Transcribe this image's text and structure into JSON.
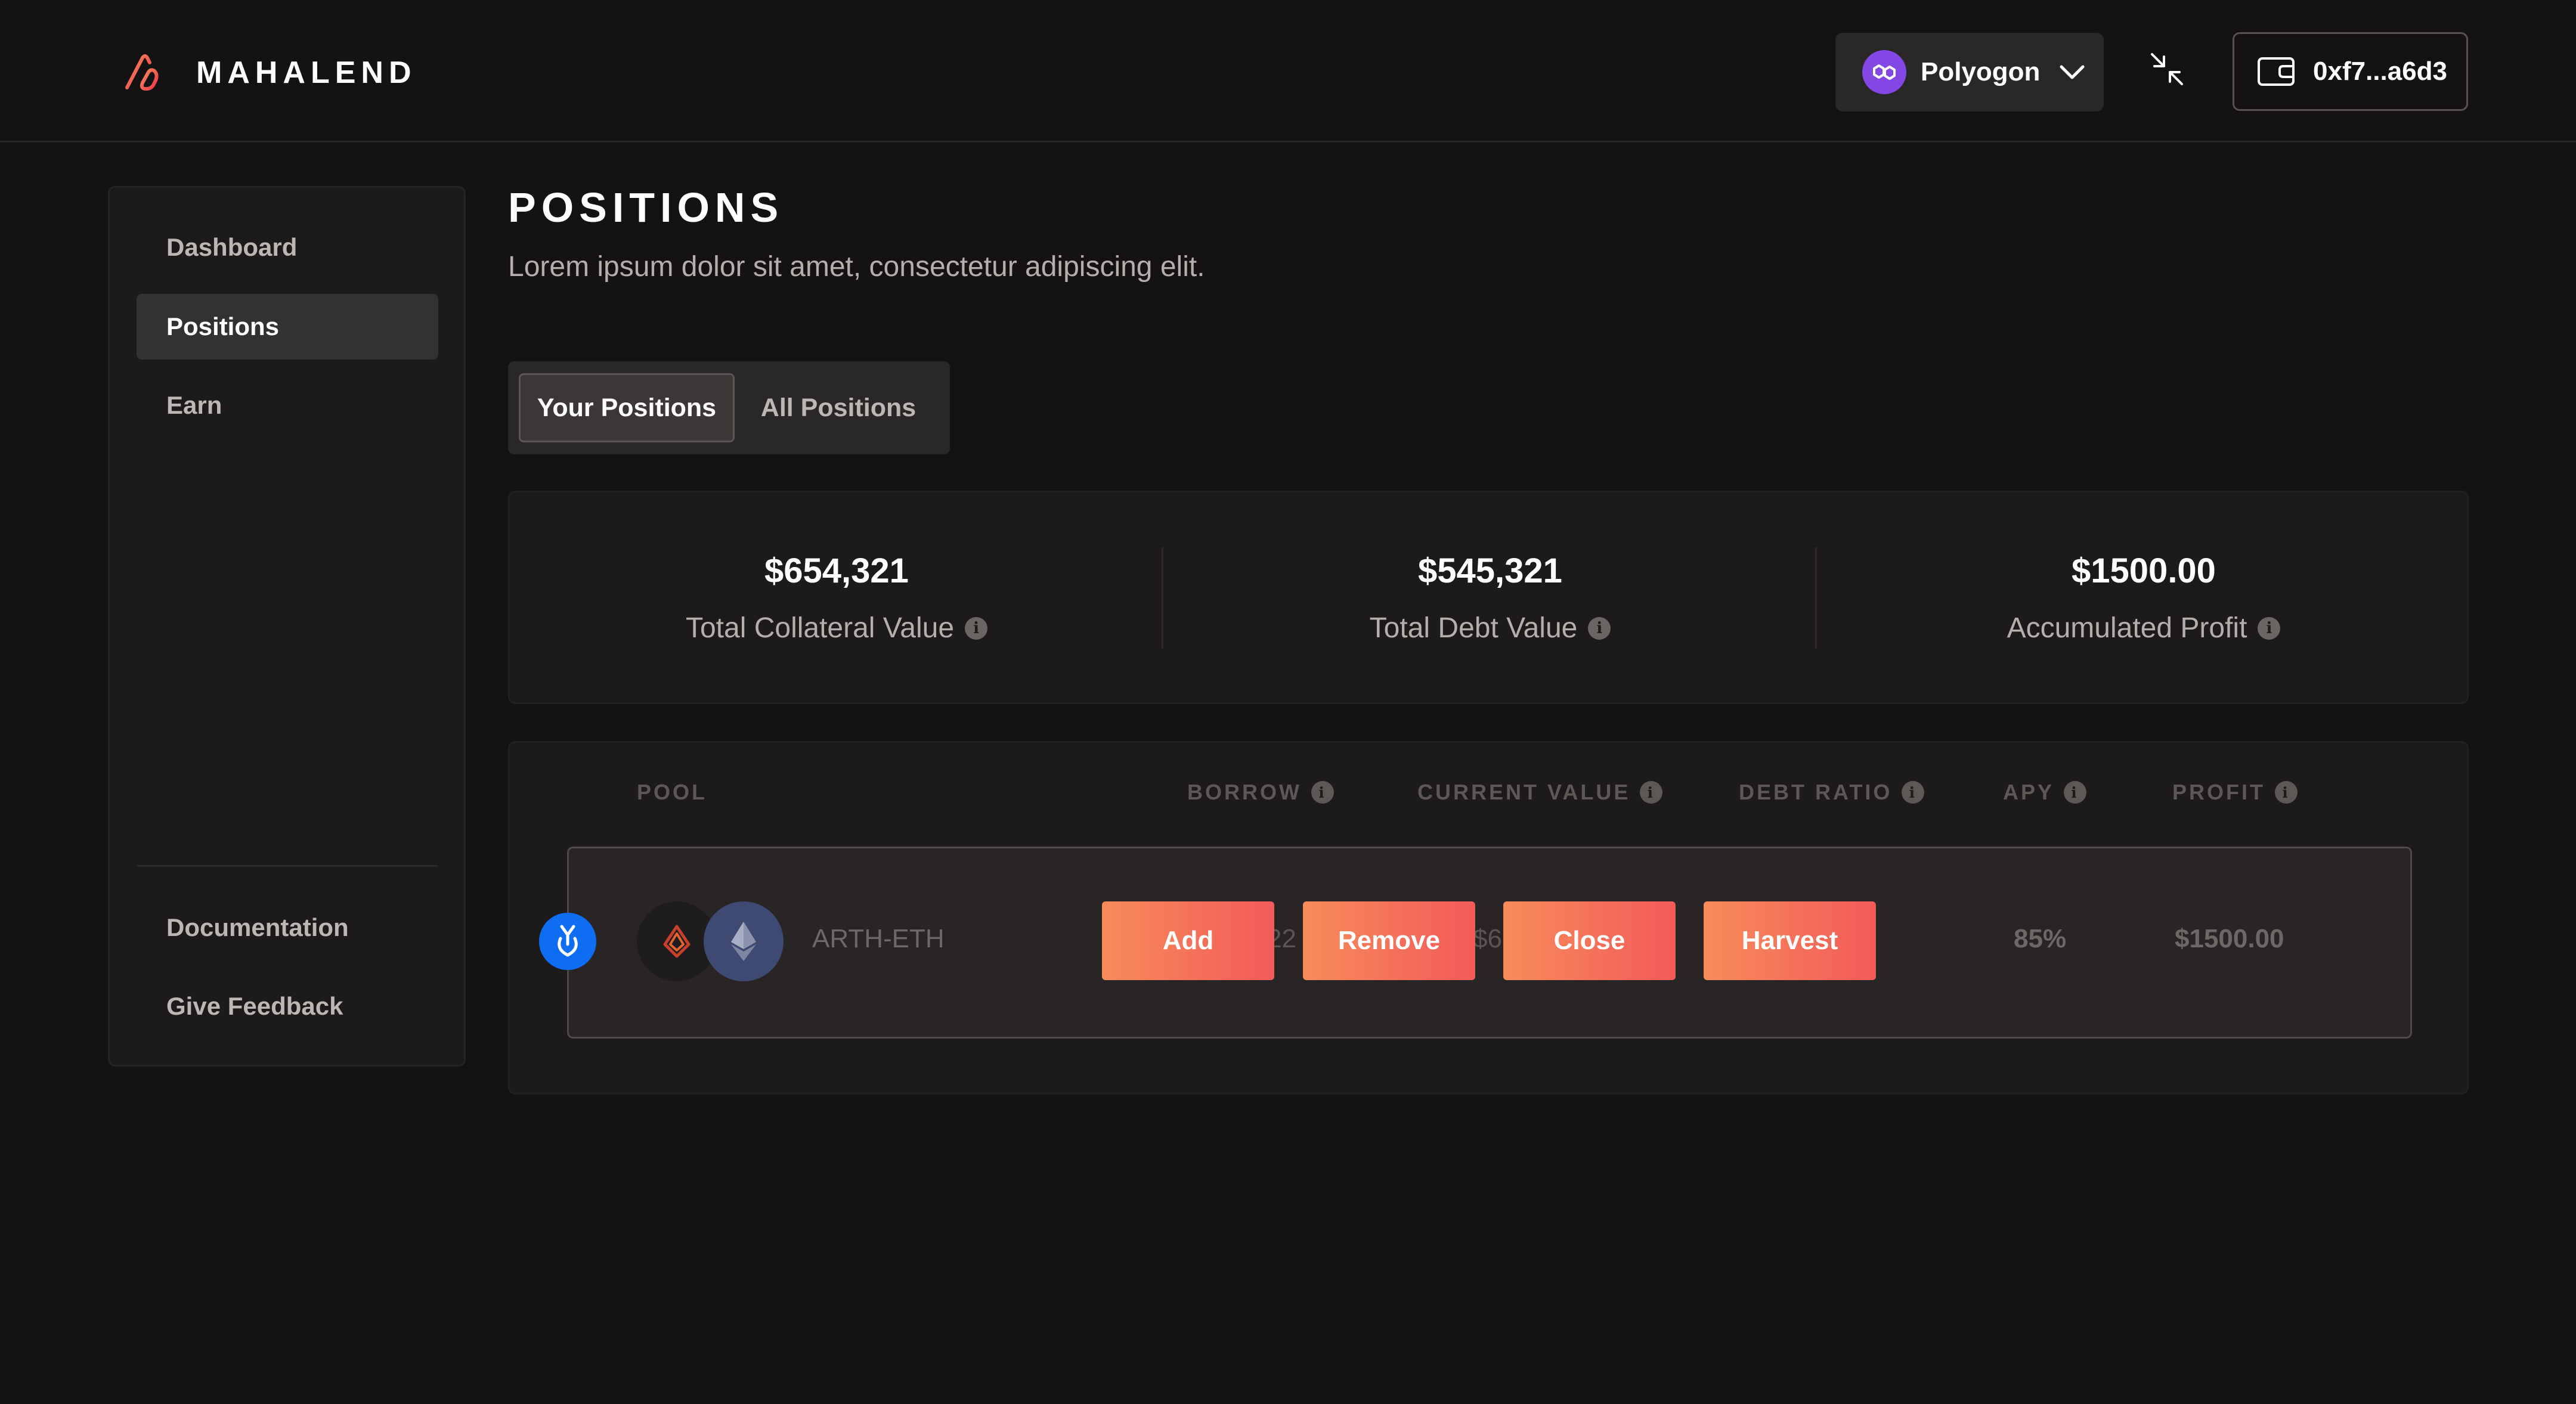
{
  "app": {
    "brand": "MAHALEND",
    "network": "Polyogon",
    "wallet": "0xf7...a6d3"
  },
  "sidebar": {
    "items": [
      {
        "label": "Dashboard"
      },
      {
        "label": "Positions"
      },
      {
        "label": "Earn"
      }
    ],
    "footer_items": [
      {
        "label": "Documentation"
      },
      {
        "label": "Give Feedback"
      }
    ]
  },
  "page": {
    "title": "POSITIONS",
    "subtitle": "Lorem ipsum dolor sit amet, consectetur adipiscing elit."
  },
  "tabs": [
    {
      "label": "Your Positions",
      "active": true
    },
    {
      "label": "All Positions",
      "active": false
    }
  ],
  "stats": [
    {
      "value": "$654,321",
      "label": "Total Collateral Value"
    },
    {
      "value": "$545,321",
      "label": "Total Debt Value"
    },
    {
      "value": "$1500.00",
      "label": "Accumulated Profit"
    }
  ],
  "table": {
    "columns": [
      "POOL",
      "BORROW",
      "CURRENT VALUE",
      "DEBT RATIO",
      "APY",
      "PROFIT"
    ],
    "rows": [
      {
        "pool": "ARTH-ETH",
        "borrow_partial": "22",
        "current_value_partial": "$6",
        "apy": "85%",
        "profit": "$1500.00",
        "actions": [
          "Add",
          "Remove",
          "Close",
          "Harvest"
        ]
      }
    ]
  },
  "colors": {
    "background": "#141213",
    "card": "#1c1a1b",
    "accent_gradient_start": "#f78c5a",
    "accent_gradient_end": "#f25a59",
    "polygon_purple": "#8247e5",
    "yearn_blue": "#0f6df2"
  },
  "icons": {
    "logo": "mahalend-logo-icon",
    "network": "polygon-icon",
    "dropdown": "chevron-down-icon",
    "collapse": "collapse-arrows-icon",
    "wallet": "wallet-icon",
    "info": "info-icon",
    "pool_protocol": "yearn-icon",
    "token_a": "arth-icon",
    "token_b": "ethereum-icon"
  }
}
